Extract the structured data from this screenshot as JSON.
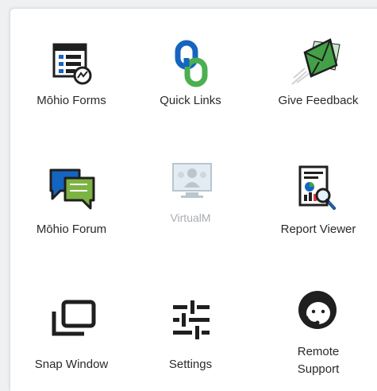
{
  "tiles": [
    {
      "label": "Mōhio Forms",
      "icon": "forms-icon",
      "enabled": true
    },
    {
      "label": "Quick  Links",
      "icon": "quick-links-icon",
      "enabled": true
    },
    {
      "label": "Give Feedback",
      "icon": "give-feedback-icon",
      "enabled": true
    },
    {
      "label": "Mōhio Forum",
      "icon": "forum-icon",
      "enabled": true
    },
    {
      "label": "VirtualM",
      "icon": "virtual-meeting-icon",
      "enabled": false
    },
    {
      "label": "Report Viewer",
      "icon": "report-viewer-icon",
      "enabled": true
    },
    {
      "label": "Snap Window",
      "icon": "snap-window-icon",
      "enabled": true
    },
    {
      "label": "Settings",
      "icon": "settings-icon",
      "enabled": true
    },
    {
      "label_line1": "Remote",
      "label_line2": "Support",
      "icon": "remote-support-icon",
      "enabled": true
    }
  ],
  "colors": {
    "dark": "#1f1f1f",
    "blue": "#1565c0",
    "green": "#4caf50",
    "forum_green": "#7cb342",
    "feedback_green": "#43a047",
    "disabled": "#b9c6cf"
  }
}
